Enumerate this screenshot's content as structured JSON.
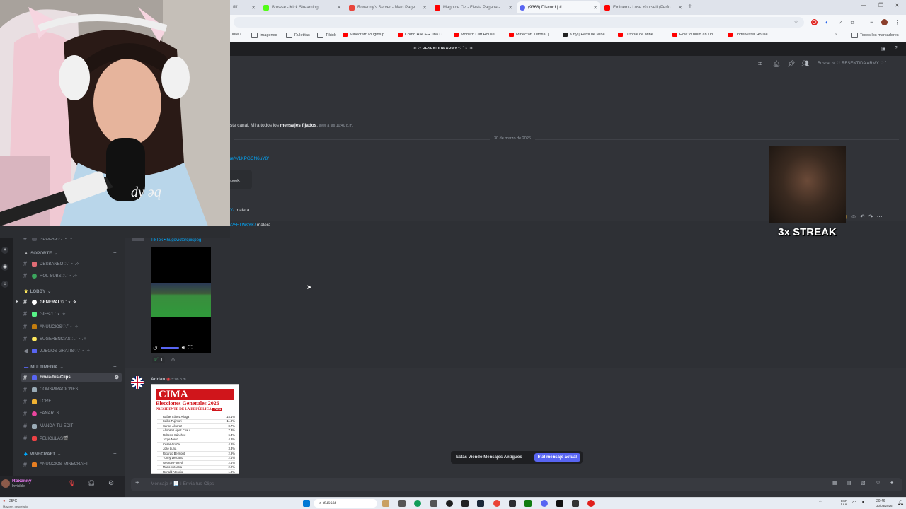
{
  "browser": {
    "tabs": [
      {
        "label": "ffff",
        "color": "#5865f2"
      },
      {
        "label": "Browse - Kick Streaming",
        "color": "#53fc18"
      },
      {
        "label": "Roxanny's Server - Main Page",
        "color": "#e8453c"
      },
      {
        "label": "Mago de Oz - Fiesta Pagana -",
        "color": "#ff0000"
      },
      {
        "label": "(9368) Discord | # ",
        "color": "#5865f2"
      },
      {
        "label": "Eminem - Lose Yourself (Perfo",
        "color": "#ff0000"
      }
    ],
    "bookmarks": [
      "Imagenes",
      "Ruletitas",
      "Tiktok",
      "Minecraft: Plugins p...",
      "Como HACER una C...",
      "Modern Cliff House...",
      "Minecraft Tutorial |...",
      "Kitty | Perfil de Mine...",
      "Tutorial de Mine...",
      "How to build an Un...",
      "Underwater House..."
    ],
    "bookmarks_right": "Todos los marcadores"
  },
  "discord": {
    "server_title": "✧ ♡ RESENTIDA ARMY ♡.˚ ⋆ .✧",
    "search_placeholder": "Buscar ✧ ♡ RESENTIDA ARMY ♡.˚...",
    "pinned_notice": {
      "prefix": "ste canal. Mira todos los",
      "link": "mensajes fijados",
      "time": "ayer a las 10:40 p.m."
    },
    "date_divider": "30 de marzo de 2026",
    "messages": {
      "link1": "ue/v/1KPGCN6uY8/",
      "embed_text": "ebook.",
      "link2_prefix": "Y/",
      "link2_text": "malera",
      "link3_prefix": "/25HLWsYK/",
      "link3_text": "malera",
      "tiktok_label": "TikTok • hugovictorquispeg",
      "reaction_count": "1",
      "adrian_name": "Adrian",
      "adrian_time": "5:08 p.m."
    },
    "poll": {
      "brand": "CIMA",
      "title": "Elecciones Generales 2026",
      "subtitle": "PRESIDENTE DE LA REPÚBLICA",
      "badge": "Perú",
      "rows": [
        {
          "name": "Rafael López Aliaga",
          "pct": "14.1%"
        },
        {
          "name": "Keiko Fujimori",
          "pct": "11.0%"
        },
        {
          "name": "Carlos Álvarez",
          "pct": "8.7%"
        },
        {
          "name": "Alfonso López Chau",
          "pct": "7.3%"
        },
        {
          "name": "Roberto Sánchez",
          "pct": "6.4%"
        },
        {
          "name": "Jorge Nieto",
          "pct": "4.8%"
        },
        {
          "name": "César Acuña",
          "pct": "4.2%"
        },
        {
          "name": "José Luna",
          "pct": "3.3%"
        },
        {
          "name": "Ricardo Belmont",
          "pct": "2.9%"
        },
        {
          "name": "Yonhy Lescano",
          "pct": "2.4%"
        },
        {
          "name": "George Forsyth",
          "pct": "2.4%"
        },
        {
          "name": "Mario Vizcarra",
          "pct": "2.2%"
        },
        {
          "name": "Ronald Atencio",
          "pct": "1.8%"
        }
      ]
    },
    "streak_text": "3x STREAK",
    "old_messages": "Estás Viendo Mensajes Antiguos",
    "jump_button": "Ir al mensaje actual",
    "composer_placeholder": "Mensaje # 📃 ⁝ Envia-tus-Clips",
    "user": {
      "name": "Roxanny",
      "status": "Invisible"
    }
  },
  "sidebar": {
    "top_partial": "REGLAS♡.˚ ⋆ .✧",
    "categories": [
      {
        "label": "SOPORTE",
        "channels": [
          {
            "name": "DESBANEO♡.˚ ⋆ .✧",
            "color": "#e06c75"
          },
          {
            "name": "ROL-SUBS♡.˚ ⋆ .✧",
            "color": "#3ba55d"
          }
        ]
      },
      {
        "label": "LOBBY",
        "channels": [
          {
            "name": "GENERAL♡.˚ ⋆ .✧",
            "color": "#ffffff"
          },
          {
            "name": "GIFS♡.˚ ⋆ .✧",
            "color": "#57f287"
          },
          {
            "name": "ANUNCIOS♡.˚ ⋆ .✧",
            "color": "#c27c0e"
          },
          {
            "name": "SUGERENCIAS♡.˚ ⋆ .✧",
            "color": "#fee75c"
          },
          {
            "name": "JUEGOS-GRATIS♡.˚ ⋆ .✧",
            "color": "#b9bbbe"
          }
        ]
      },
      {
        "label": "MULTIMEDIA",
        "channels": [
          {
            "name": "Envia-tus-Clips",
            "color": "#5865f2"
          },
          {
            "name": "CONSPIRACIONES",
            "color": "#99aab5"
          },
          {
            "name": "LORE",
            "color": "#f0b232"
          },
          {
            "name": "FANARTS",
            "color": "#eb459e"
          },
          {
            "name": "MANDA-TU-EDIT",
            "color": "#99aab5"
          },
          {
            "name": "PELICULAS🎬",
            "color": "#ed4245"
          }
        ]
      },
      {
        "label": "MINECRAFT",
        "channels": [
          {
            "name": "ANUNCIOS-MINECRAFT",
            "color": "#e67e22"
          }
        ]
      }
    ]
  },
  "taskbar": {
    "search": "Buscar",
    "weather": "25°C",
    "weather_sub": "Mayorm. despejado",
    "lang": "ESP LAA",
    "time": "20:46",
    "date": "30/03/2026"
  }
}
